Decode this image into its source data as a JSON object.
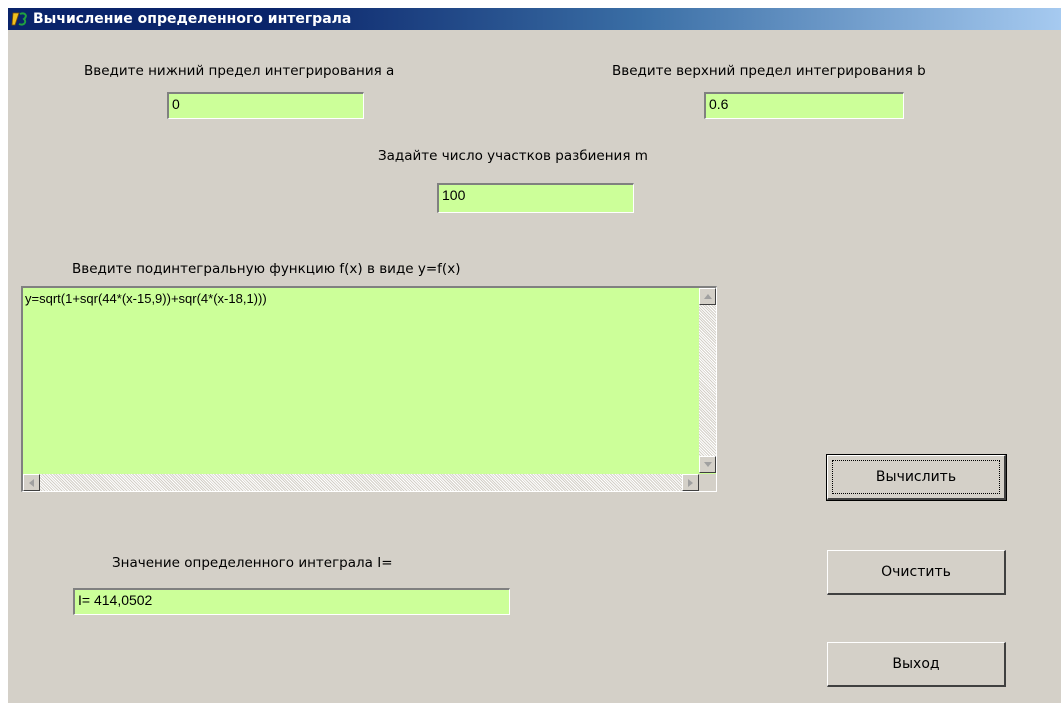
{
  "window": {
    "title": "Вычисление определенного интеграла"
  },
  "form": {
    "lower_label": "Введите нижний предел интегрирования  a",
    "lower_value": "0",
    "upper_label": "Введите верхний предел интегрирования  b",
    "upper_value": "0.6",
    "partition_label": "Задайте число участков разбиения  m",
    "partition_value": "100",
    "function_label": "Введите подинтегральную функцию f(x) в виде  y=f(x)",
    "function_value": "y=sqrt(1+sqr(44*(x-15,9))+sqr(4*(x-18,1)))",
    "result_label": "Значение определенного интеграла  I=",
    "result_value": "I=  414,0502"
  },
  "buttons": {
    "calculate": "Вычислить",
    "clear": "Очистить",
    "exit": "Выход"
  },
  "colors": {
    "field_background": "#ccff99",
    "window_background": "#d4d0c8",
    "titlebar": "#0a246a"
  }
}
